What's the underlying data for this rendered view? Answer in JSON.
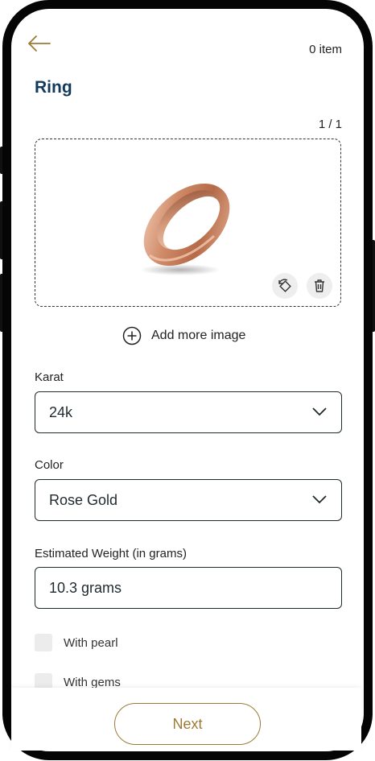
{
  "header": {
    "item_count": "0 item",
    "title": "Ring"
  },
  "image_area": {
    "counter": "1 / 1",
    "add_more_label": "Add more image"
  },
  "form": {
    "karat": {
      "label": "Karat",
      "value": "24k"
    },
    "color": {
      "label": "Color",
      "value": "Rose Gold"
    },
    "weight": {
      "label": "Estimated Weight (in grams)",
      "value": "10.3 grams"
    }
  },
  "checkboxes": [
    {
      "label": "With pearl",
      "checked": false
    },
    {
      "label": "With gems",
      "checked": false
    }
  ],
  "footer": {
    "next_label": "Next"
  },
  "colors": {
    "accent": "#9c7a35",
    "title": "#123a5c",
    "text": "#1f2a2e"
  },
  "icons": [
    "back-arrow-icon",
    "rotate-icon",
    "trash-icon",
    "plus-circle-icon",
    "chevron-down-icon"
  ]
}
